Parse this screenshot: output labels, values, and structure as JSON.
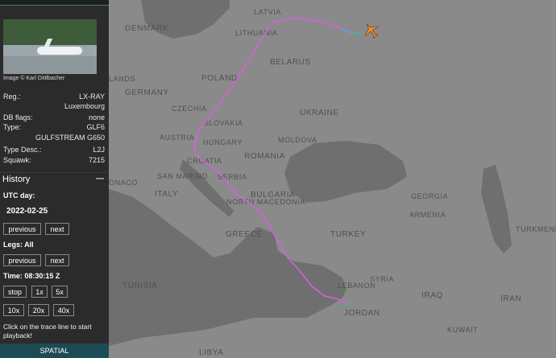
{
  "sidebar": {
    "photo_credit": "Image © Karl Dittlbacher",
    "details": [
      {
        "key": "Reg.:",
        "value": "LX-RAY"
      },
      {
        "key": "",
        "value": "Luxembourg"
      },
      {
        "key": "DB flags:",
        "value": "none"
      },
      {
        "key": "Type:",
        "value": "GLF6"
      },
      {
        "key": "",
        "value": "GULFSTREAM G650"
      },
      {
        "key": "Type Desc.:",
        "value": "L2J"
      },
      {
        "key": "Squawk:",
        "value": "7215"
      }
    ],
    "history": {
      "title": "History",
      "utc_day_label": "UTC day:",
      "date": "2022-02-25",
      "day_prev": "previous",
      "day_next": "next",
      "legs_label": "Legs: All",
      "legs_prev": "previous",
      "legs_next": "next",
      "time_label": "Time: 08:30:15 Z",
      "controls": [
        "stop",
        "1x",
        "5x"
      ],
      "speeds": [
        "10x",
        "20x",
        "40x"
      ],
      "hint": "Click on the trace line to start playback!",
      "spatial": "SPATIAL"
    }
  },
  "map": {
    "labels": [
      "DENMARK",
      "LATVIA",
      "LITHUANIA",
      "BELARUS",
      "GERMANY",
      "POLAND",
      "CZECHIA",
      "SLOVAKIA",
      "UKRAINE",
      "AUSTRIA",
      "HUNGARY",
      "MOLDOVA",
      "ROMANIA",
      "CROATIA",
      "SAN MARINO",
      "SERBIA",
      "ITALY",
      "BULGARIA",
      "NORTH MACEDONIA",
      "GREECE",
      "TURKEY",
      "GEORGIA",
      "ARMENIA",
      "TURKMENISTAN",
      "SYRIA",
      "LEBANON",
      "IRAQ",
      "JORDAN",
      "IRAN",
      "TUNISIA",
      "KUWAIT",
      "LIBYA",
      "LANDS",
      "ONACO"
    ],
    "colors": {
      "track": "#d75fe0",
      "aircraft": "#f28a2e",
      "water": "#707070",
      "land": "#8a8a8a"
    }
  }
}
